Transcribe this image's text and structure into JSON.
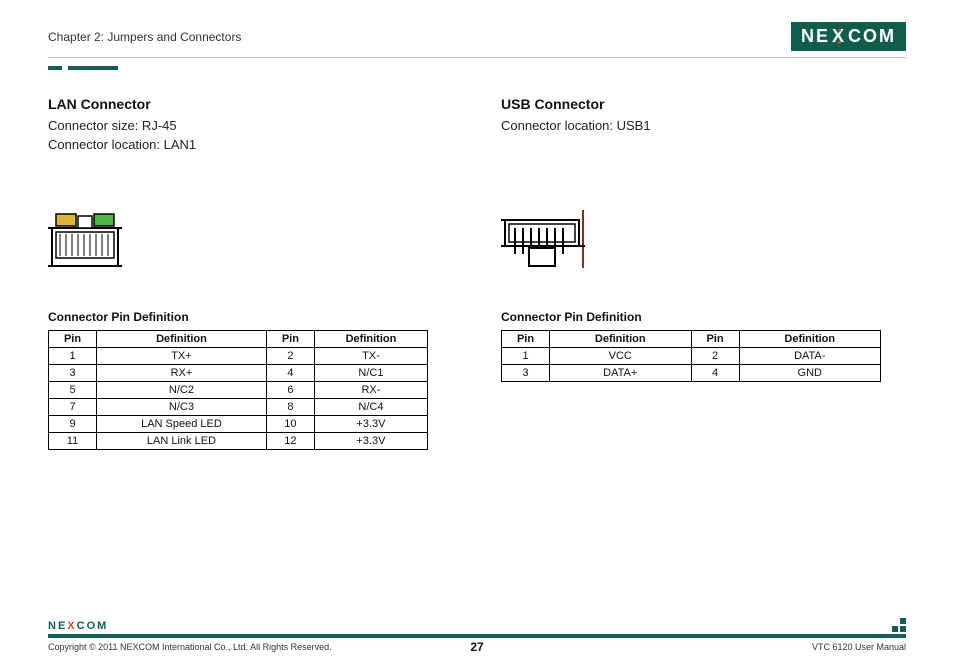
{
  "header": {
    "chapter": "Chapter 2: Jumpers and Connectors",
    "logo_text_left": "NE",
    "logo_text_x": "X",
    "logo_text_right": "COM"
  },
  "left": {
    "title": "LAN Connector",
    "size_line": "Connector size: RJ-45",
    "loc_line": "Connector location: LAN1",
    "table_title": "Connector Pin Definition",
    "headers": {
      "pin": "Pin",
      "def": "Definition"
    },
    "rows": [
      {
        "p1": "1",
        "d1": "TX+",
        "p2": "2",
        "d2": "TX-"
      },
      {
        "p1": "3",
        "d1": "RX+",
        "p2": "4",
        "d2": "N/C1"
      },
      {
        "p1": "5",
        "d1": "N/C2",
        "p2": "6",
        "d2": "RX-"
      },
      {
        "p1": "7",
        "d1": "N/C3",
        "p2": "8",
        "d2": "N/C4"
      },
      {
        "p1": "9",
        "d1": "LAN Speed LED",
        "p2": "10",
        "d2": "+3.3V"
      },
      {
        "p1": "11",
        "d1": "LAN Link LED",
        "p2": "12",
        "d2": "+3.3V"
      }
    ]
  },
  "right": {
    "title": "USB Connector",
    "loc_line": "Connector location: USB1",
    "table_title": "Connector Pin Definition",
    "headers": {
      "pin": "Pin",
      "def": "Definition"
    },
    "rows": [
      {
        "p1": "1",
        "d1": "VCC",
        "p2": "2",
        "d2": "DATA-"
      },
      {
        "p1": "3",
        "d1": "DATA+",
        "p2": "4",
        "d2": "GND"
      }
    ]
  },
  "footer": {
    "logo_small": "NE  COM",
    "copyright": "Copyright © 2011 NEXCOM International Co., Ltd. All Rights Reserved.",
    "page": "27",
    "manual": "VTC 6120 User Manual"
  }
}
